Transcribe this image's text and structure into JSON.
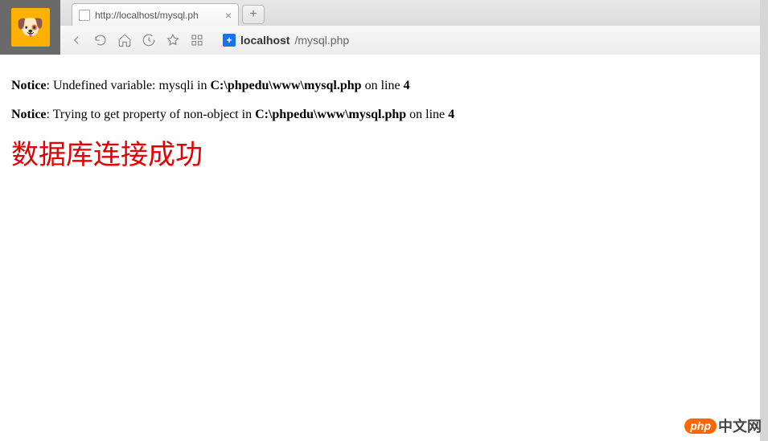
{
  "browser": {
    "tab": {
      "title": "http://localhost/mysql.ph"
    },
    "url": {
      "host": "localhost",
      "path": "/mysql.php"
    }
  },
  "notices": [
    {
      "label": "Notice",
      "sep": ": ",
      "msg_pre": "Undefined variable: mysqli in ",
      "file": "C:\\phpedu\\www\\mysql.php",
      "on_line": " on line ",
      "line": "4"
    },
    {
      "label": "Notice",
      "sep": ": ",
      "msg_pre": "Trying to get property of non-object in ",
      "file": "C:\\phpedu\\www\\mysql.php",
      "on_line": " on line ",
      "line": "4"
    }
  ],
  "heading": "数据库连接成功",
  "watermark": {
    "badge": "php",
    "text": "中文网"
  }
}
